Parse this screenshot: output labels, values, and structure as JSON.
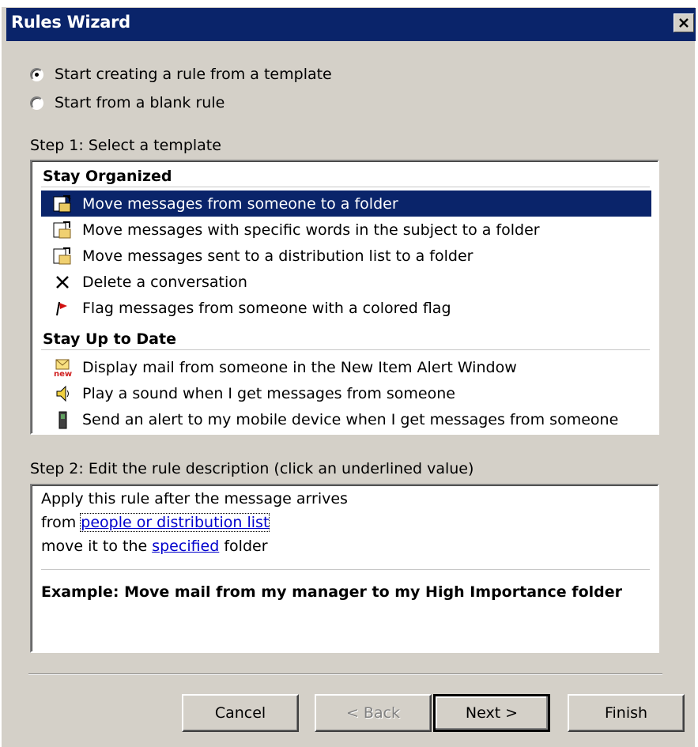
{
  "window": {
    "title": "Rules Wizard"
  },
  "mode": {
    "options": [
      {
        "label": "Start creating a rule from a template",
        "selected": true
      },
      {
        "label": "Start from a blank rule",
        "selected": false
      }
    ]
  },
  "step1": {
    "label": "Step 1: Select a template",
    "groups": [
      {
        "header": "Stay Organized",
        "items": [
          {
            "label": "Move messages from someone to a folder",
            "icon": "move-to-folder-icon",
            "selected": true
          },
          {
            "label": "Move messages with specific words in the subject to a folder",
            "icon": "move-to-folder-icon",
            "selected": false
          },
          {
            "label": "Move messages sent to a distribution list to a folder",
            "icon": "move-to-folder-icon",
            "selected": false
          },
          {
            "label": "Delete a conversation",
            "icon": "delete-x-icon",
            "selected": false
          },
          {
            "label": "Flag messages from someone with a colored flag",
            "icon": "red-flag-icon",
            "selected": false
          }
        ]
      },
      {
        "header": "Stay Up to Date",
        "items": [
          {
            "label": "Display mail from someone in the New Item Alert Window",
            "icon": "new-mail-alert-icon",
            "selected": false
          },
          {
            "label": "Play a sound when I get messages from someone",
            "icon": "speaker-icon",
            "selected": false
          },
          {
            "label": "Send an alert to my mobile device when I get messages from someone",
            "icon": "mobile-device-icon",
            "selected": false
          }
        ]
      }
    ]
  },
  "step2": {
    "label": "Step 2: Edit the rule description (click an underlined value)",
    "line1": "Apply this rule after the message arrives",
    "line2_prefix": "from ",
    "line2_link": "people or distribution list",
    "line3_prefix": "move it to the ",
    "line3_link": "specified",
    "line3_suffix": " folder",
    "example": "Example: Move mail from my manager to my High Importance folder"
  },
  "buttons": {
    "cancel": "Cancel",
    "back": "< Back",
    "next": "Next >",
    "finish": "Finish"
  },
  "colors": {
    "titlebar": "#0a246a",
    "selection": "#0a246a",
    "face": "#d4d0c8",
    "link": "#0000cc"
  }
}
